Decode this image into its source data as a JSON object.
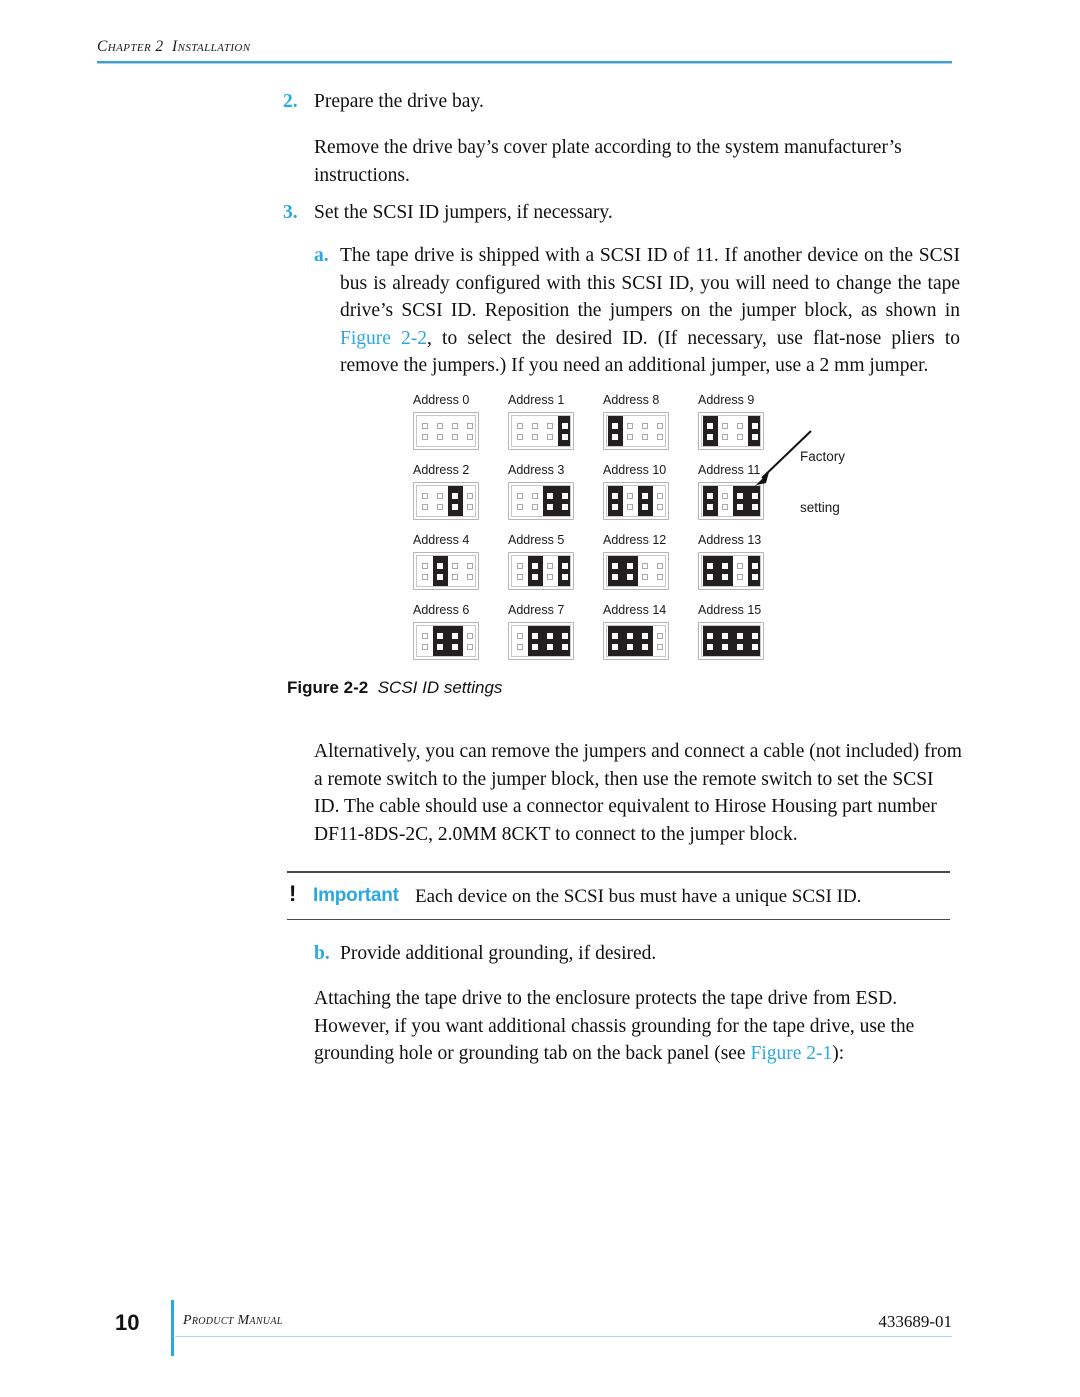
{
  "header": {
    "chapter_label": "Chapter 2  Installation",
    "rule_color": "#2ba8e0"
  },
  "steps": {
    "step2_marker": "2.",
    "step2_title": "Prepare the drive bay.",
    "step2_body": "Remove the drive bay’s cover plate according to the system manufacturer’s instructions.",
    "step3_marker": "3.",
    "step3_title": "Set the SCSI ID jumpers, if necessary.",
    "step3a_marker": "a.",
    "step3a_text_part1": "The tape drive is shipped with a SCSI ID of 11. If another device on the SCSI bus is already configured with this SCSI ID, you will need to change the tape drive’s SCSI ID. Reposition the jumpers on the jumper block, as shown in ",
    "step3a_link": "Figure 2-2",
    "step3a_text_part2": ", to select the desired ID. (If necessary, use flat-nose pliers to remove the jumpers.) If you need an additional jumper, use a 2 mm jumper.",
    "alt_paragraph": "Alternatively, you can remove the jumpers and connect a cable (not included) from a remote switch to the jumper block, then use the remote switch to set the SCSI ID. The cable should use a connector equivalent to Hirose Housing part number DF11-8DS-2C, 2.0MM 8CKT to connect to the jumper block.",
    "step3b_marker": "b.",
    "step3b_title": "Provide additional grounding, if desired.",
    "step3b_text_part1": "Attaching the tape drive to the enclosure protects the tape drive from ESD. However, if you want additional chassis grounding for the tape drive, use the grounding hole or grounding tab on the back panel (see ",
    "step3b_link": "Figure 2-1",
    "step3b_text_part2": "):"
  },
  "figure": {
    "caption_number": "Figure 2-2",
    "caption_title": "SCSI ID settings",
    "callout_line1": "Factory",
    "callout_line2": "setting",
    "callout_target": "Address 11",
    "columns": 4,
    "rows_of_pins": 2,
    "jumper_color": "#231f20",
    "blocks": [
      {
        "label": "Address 0",
        "jumpers": []
      },
      {
        "label": "Address 1",
        "jumpers": [
          4
        ]
      },
      {
        "label": "Address 8",
        "jumpers": [
          1
        ]
      },
      {
        "label": "Address 9",
        "jumpers": [
          1,
          4
        ]
      },
      {
        "label": "Address 2",
        "jumpers": [
          3
        ]
      },
      {
        "label": "Address 3",
        "jumpers": [
          3,
          4
        ]
      },
      {
        "label": "Address 10",
        "jumpers": [
          1,
          3
        ]
      },
      {
        "label": "Address 11",
        "jumpers": [
          1,
          3,
          4
        ]
      },
      {
        "label": "Address 4",
        "jumpers": [
          2
        ]
      },
      {
        "label": "Address 5",
        "jumpers": [
          2,
          4
        ]
      },
      {
        "label": "Address 12",
        "jumpers": [
          1,
          2
        ]
      },
      {
        "label": "Address 13",
        "jumpers": [
          1,
          2,
          4
        ]
      },
      {
        "label": "Address 6",
        "jumpers": [
          2,
          3
        ]
      },
      {
        "label": "Address 7",
        "jumpers": [
          2,
          3,
          4
        ]
      },
      {
        "label": "Address 14",
        "jumpers": [
          1,
          2,
          3
        ]
      },
      {
        "label": "Address 15",
        "jumpers": [
          1,
          2,
          3,
          4
        ]
      }
    ]
  },
  "note": {
    "icon": "exclamation-icon",
    "label": "Important",
    "label_color": "#2ba8e0",
    "text": "Each device on the SCSI bus must have a unique SCSI ID."
  },
  "footer": {
    "page_number": "10",
    "manual_label": "Product Manual",
    "part_number": "433689-01",
    "accent_color": "#2ba8e0"
  }
}
